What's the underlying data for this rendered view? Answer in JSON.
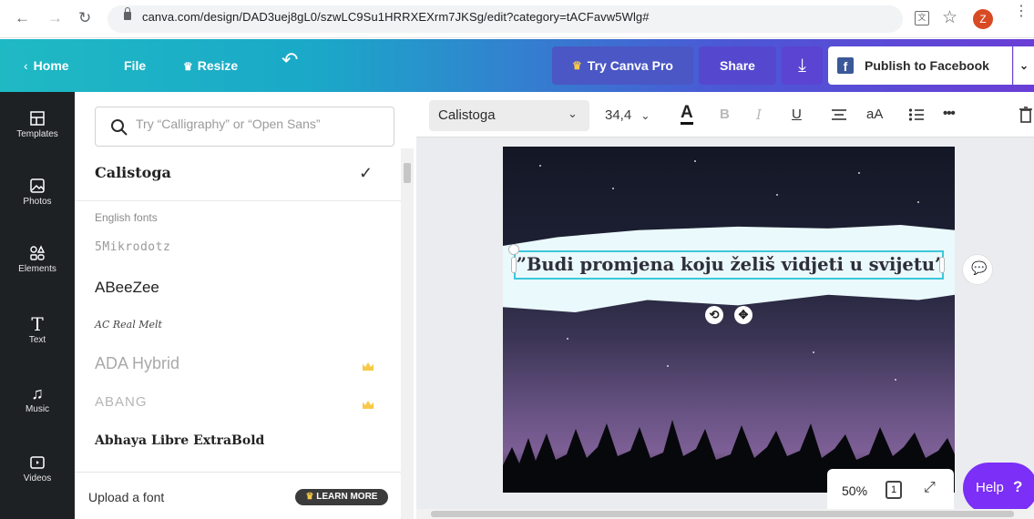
{
  "browser": {
    "url": "canva.com/design/DAD3uej8gL0/szwLC9Su1HRRXEXrm7JKSg/edit?category=tACFavw5Wlg#",
    "profile_initial": "Z",
    "back_icon": "back-arrow-icon",
    "forward_icon": "forward-arrow-icon",
    "reload_icon": "reload-icon"
  },
  "topbar": {
    "home_label": "Home",
    "file_label": "File",
    "resize_label": "Resize",
    "undo_icon": "undo-icon",
    "try_pro_label": "Try Canva Pro",
    "share_label": "Share",
    "download_icon": "download-icon",
    "publish_label": "Publish to Facebook",
    "colors": {
      "brand_start": "#1fb9c4",
      "brand_end": "#6a3ed6",
      "crown": "#f7c948"
    }
  },
  "rail": {
    "items": [
      {
        "label": "Templates",
        "icon": "templates-icon"
      },
      {
        "label": "Photos",
        "icon": "photos-icon"
      },
      {
        "label": "Elements",
        "icon": "elements-icon"
      },
      {
        "label": "Text",
        "icon": "text-icon"
      },
      {
        "label": "Music",
        "icon": "music-icon"
      },
      {
        "label": "Videos",
        "icon": "videos-icon"
      }
    ]
  },
  "font_panel": {
    "search_placeholder": "Try “Calligraphy” or “Open Sans”",
    "selected_font": "Calistoga",
    "section_label": "English fonts",
    "fonts": [
      {
        "name": "5Mikrodotz",
        "pro": false
      },
      {
        "name": "ABeeZee",
        "pro": false
      },
      {
        "name": "AC Real Melt",
        "pro": false
      },
      {
        "name": "ADA Hybrid",
        "pro": true
      },
      {
        "name": "ABANG",
        "pro": true
      },
      {
        "name": "Abhaya Libre ExtraBold",
        "pro": false
      }
    ],
    "upload_label": "Upload a font",
    "learn_more_label": "LEARN MORE"
  },
  "text_toolbar": {
    "font_name": "Calistoga",
    "font_size": "34,4",
    "case_label": "aA",
    "more_label": "•••",
    "color_label": "A",
    "bold_label": "B",
    "italic_label": "I",
    "underline_label": "U"
  },
  "design": {
    "text": "”Budi promjena koju želiš vidjeti u svijetu”"
  },
  "footer": {
    "zoom": "50%",
    "page_number": "1",
    "help_label": "Help",
    "help_mark": "?"
  }
}
